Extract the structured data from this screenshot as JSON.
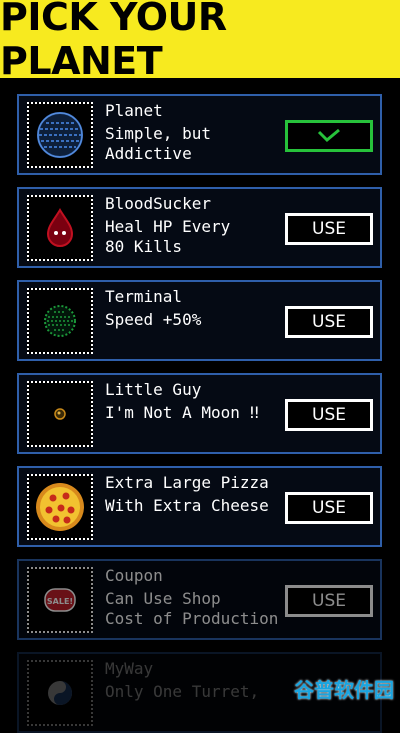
{
  "header": {
    "title": "PICK YOUR PLANET"
  },
  "planets": [
    {
      "title": "Planet",
      "desc": "Simple, but\nAddictive",
      "button": "",
      "selected": true
    },
    {
      "title": "BloodSucker",
      "desc": "Heal HP Every\n80 Kills",
      "button": "USE",
      "selected": false
    },
    {
      "title": "Terminal",
      "desc": "Speed +50%",
      "button": "USE",
      "selected": false
    },
    {
      "title": "Little Guy",
      "desc": "I'm Not A Moon ‼",
      "button": "USE",
      "selected": false
    },
    {
      "title": "Extra Large Pizza",
      "desc": "With Extra Cheese",
      "button": "USE",
      "selected": false
    },
    {
      "title": "Coupon",
      "desc": "Can Use Shop\nCost of Production",
      "button": "USE",
      "selected": false
    },
    {
      "title": "MyWay",
      "desc": "Only One Turret,",
      "button": "",
      "selected": false
    }
  ],
  "coupon_sign": "SALE!",
  "watermark": "谷普软件园",
  "icons": {
    "selected_check": "check-icon",
    "planet": "blue-planet-icon",
    "bloodsucker": "blood-drop-icon",
    "terminal": "green-terminal-planet-icon",
    "little_guy": "tiny-planet-icon",
    "pizza": "pizza-icon",
    "coupon": "sale-sign-icon",
    "myway": "yin-yang-icon"
  },
  "colors": {
    "header": "#f7ea1f",
    "card_border": "#2f5faa",
    "selected": "#27c23b"
  }
}
